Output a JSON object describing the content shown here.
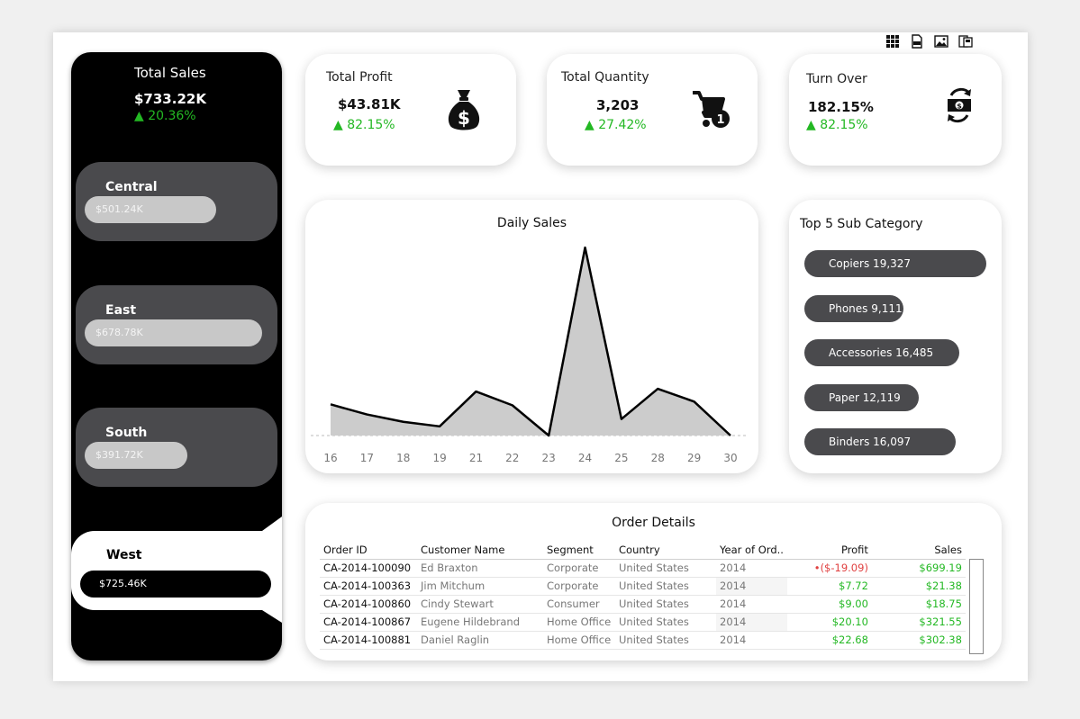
{
  "toolbar": {
    "items": [
      {
        "name": "grid-icon"
      },
      {
        "name": "pdf-icon"
      },
      {
        "name": "image-icon"
      },
      {
        "name": "ppt-icon"
      }
    ]
  },
  "summary": {
    "label": "Total Sales",
    "value": "$733.22K",
    "change": "▲ 20.36%"
  },
  "regions": [
    {
      "name": "Central",
      "value": "$501.24K",
      "fill": 0.69
    },
    {
      "name": "East",
      "value": "$678.78K",
      "fill": 0.93
    },
    {
      "name": "South",
      "value": "$391.72K",
      "fill": 0.54
    }
  ],
  "region_selected": {
    "name": "West",
    "value": "$725.46K",
    "fill": 1.0
  },
  "kpis": [
    {
      "label": "Total Profit",
      "value": "$43.81K",
      "change": "▲ 82.15%",
      "icon": "money-bag-icon"
    },
    {
      "label": "Total Quantity",
      "value": "3,203",
      "change": "▲ 27.42%",
      "icon": "cart-icon"
    },
    {
      "label": "Turn Over",
      "value": "182.15%",
      "change": "▲ 82.15%",
      "icon": "cash-exchange-icon"
    }
  ],
  "chart_data": {
    "type": "area",
    "title": "Daily Sales",
    "xlabel": "",
    "ylabel": "",
    "x": [
      16,
      17,
      18,
      19,
      21,
      22,
      23,
      24,
      25,
      28,
      29,
      30
    ],
    "values": [
      34,
      23,
      15,
      10,
      48,
      33,
      0,
      205,
      18,
      51,
      37,
      0
    ],
    "ylim": [
      0,
      210
    ],
    "grid": false
  },
  "subcategory": {
    "title": "Top 5 Sub Category",
    "items": [
      {
        "label": "Copiers 19,327",
        "value": 19327
      },
      {
        "label": "Phones 9,111",
        "value": 9111
      },
      {
        "label": "Accessories 16,485",
        "value": 16485
      },
      {
        "label": "Paper 12,119",
        "value": 12119
      },
      {
        "label": "Binders 16,097",
        "value": 16097
      }
    ]
  },
  "orders": {
    "title": "Order Details",
    "columns": [
      "Order ID",
      "Customer Name",
      "Segment",
      "Country",
      "Year of Ord..",
      "Profit",
      "Sales"
    ],
    "rows": [
      [
        "CA-2014-100090",
        "Ed Braxton",
        "Corporate",
        "United States",
        "2014",
        "•($-19.09)",
        "$699.19"
      ],
      [
        "CA-2014-100363",
        "Jim Mitchum",
        "Corporate",
        "United States",
        "2014",
        "$7.72",
        "$21.38"
      ],
      [
        "CA-2014-100860",
        "Cindy Stewart",
        "Consumer",
        "United States",
        "2014",
        "$9.00",
        "$18.75"
      ],
      [
        "CA-2014-100867",
        "Eugene Hildebrand",
        "Home Office",
        "United States",
        "2014",
        "$20.10",
        "$321.55"
      ],
      [
        "CA-2014-100881",
        "Daniel Raglin",
        "Home Office",
        "United States",
        "2014",
        "$22.68",
        "$302.38"
      ]
    ]
  },
  "colors": {
    "positive": "#23b823",
    "negative": "#e04040",
    "pill": "#4a4a4d",
    "area_fill": "#cccccc"
  }
}
